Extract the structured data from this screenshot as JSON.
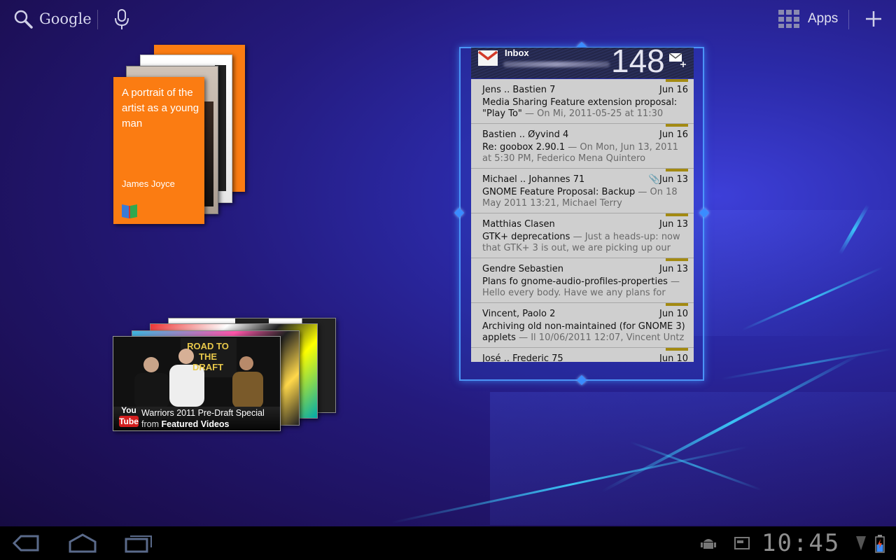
{
  "topbar": {
    "search_label": "Google",
    "apps_label": "Apps"
  },
  "book_widget": {
    "title": "A portrait of the artist as a young man",
    "author": "James Joyce"
  },
  "youtube_widget": {
    "logo_you": "You",
    "logo_tube": "Tube",
    "video_title": "Warriors 2011 Pre-Draft Special",
    "from_prefix": "from",
    "from_source": "Featured Videos",
    "thumb_text": "ROAD TO THE DRAFT"
  },
  "gmail_widget": {
    "label": "Inbox",
    "unread_count": "148",
    "messages": [
      {
        "from": "Jens .. Bastien  7",
        "date": "Jun 16",
        "subject": "Media Sharing Feature extension proposal: \"Play To\"",
        "snippet": " — On Mi, 2011-05-25 at 11:30",
        "attachment": false
      },
      {
        "from": "Bastien .. Øyvind  4",
        "date": "Jun 16",
        "subject": "Re: goobox 2.90.1",
        "snippet": " — On Mon, Jun 13, 2011 at 5:30 PM, Federico Mena Quintero",
        "attachment": false
      },
      {
        "from": "Michael .. Johannes  71",
        "date": "Jun 13",
        "subject": "GNOME Feature Proposal: Backup",
        "snippet": " — On 18 May 2011 13:21, Michael Terry",
        "attachment": true
      },
      {
        "from": "Matthias Clasen",
        "date": "Jun 13",
        "subject": "GTK+ deprecations",
        "snippet": " — Just a heads-up: now that GTK+ 3 is out, we are picking up our",
        "attachment": false
      },
      {
        "from": "Gendre Sebastien",
        "date": "Jun 13",
        "subject": "Plans fo gnome-audio-profiles-properties",
        "snippet": " — Hello every body. Have we any plans for",
        "attachment": false
      },
      {
        "from": "Vincent, Paolo  2",
        "date": "Jun 10",
        "subject": "Archiving old non-maintained (for GNOME 3) applets",
        "snippet": " — Il 10/06/2011 12:07, Vincent Untz",
        "attachment": false
      },
      {
        "from": "José .. Frederic  75",
        "date": "Jun 10",
        "subject": "",
        "snippet": "",
        "attachment": false
      }
    ]
  },
  "system_bar": {
    "clock": "10:45"
  },
  "colors": {
    "book_orange": "#fb7c12",
    "gmail_marker": "#a38a12",
    "frame_blue": "#3a8cff"
  }
}
